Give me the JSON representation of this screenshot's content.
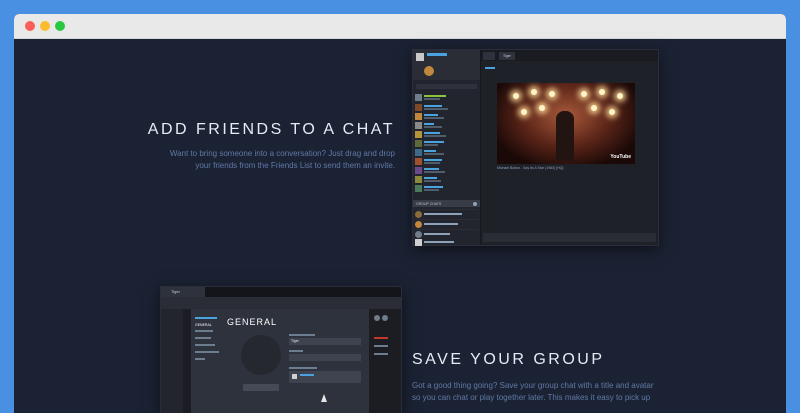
{
  "browser": {
    "controls": [
      "close",
      "minimize",
      "maximize"
    ]
  },
  "features": [
    {
      "title": "ADD FRIENDS TO A CHAT",
      "description": "Want to bring someone into a conversation? Just drag and drop your friends from the Friends List to send them an invite."
    },
    {
      "title": "SAVE YOUR GROUP",
      "description": "Got a good thing going? Save your group chat with a title and avatar so you can chat or play together later. This makes it easy to pick up"
    }
  ],
  "chat_screenshot": {
    "active_tab": "Tiger",
    "group_header": "GROUP CHATS",
    "video_badge": "YouTube",
    "video_caption": "Michael Bolton - Say Its A Star (1983) [HQ]"
  },
  "group_screenshot": {
    "tab": "Tiger",
    "section_title": "GENERAL",
    "active_nav": "GENERAL",
    "name_value": "Tiger"
  },
  "colors": {
    "background": "#1b2233",
    "heading": "#e6ecf5",
    "description": "#5f7aa6",
    "frame": "#4a90e2"
  }
}
